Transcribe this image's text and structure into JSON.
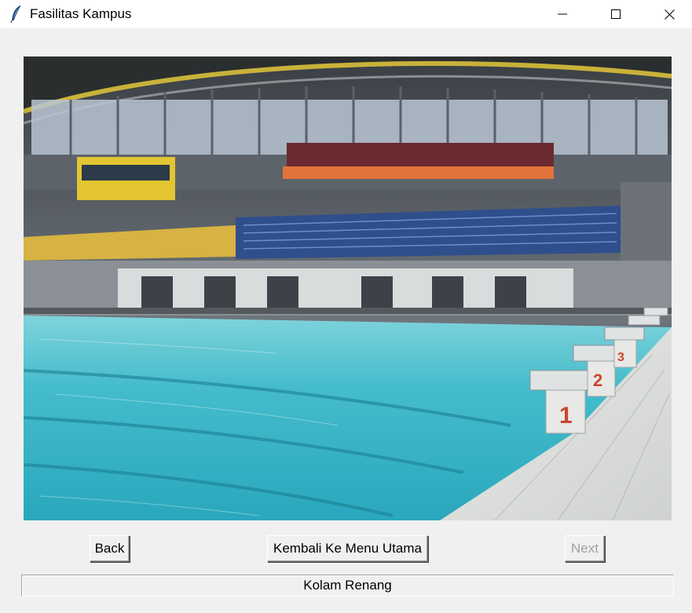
{
  "window": {
    "title": "Fasilitas Kampus",
    "icon": "feather-icon",
    "controls": [
      "minimize-icon",
      "maximize-icon",
      "close-icon"
    ]
  },
  "image": {
    "subject": "Indoor swimming pool with spectator stands",
    "lane_numbers": [
      "1",
      "2",
      "3"
    ]
  },
  "buttons": {
    "back_label": "Back",
    "menu_label": "Kembali Ke Menu Utama",
    "next_label": "Next",
    "next_enabled": false
  },
  "status": {
    "text": "Kolam Renang"
  },
  "colors": {
    "window_bg": "#f0f0f0",
    "titlebar_bg": "#ffffff",
    "disabled_text": "#a0a0a0",
    "water": "#3fb6c8",
    "stand_blue": "#2f4e8c",
    "stand_yellow": "#d8b43a",
    "stand_orange": "#e0703a"
  }
}
